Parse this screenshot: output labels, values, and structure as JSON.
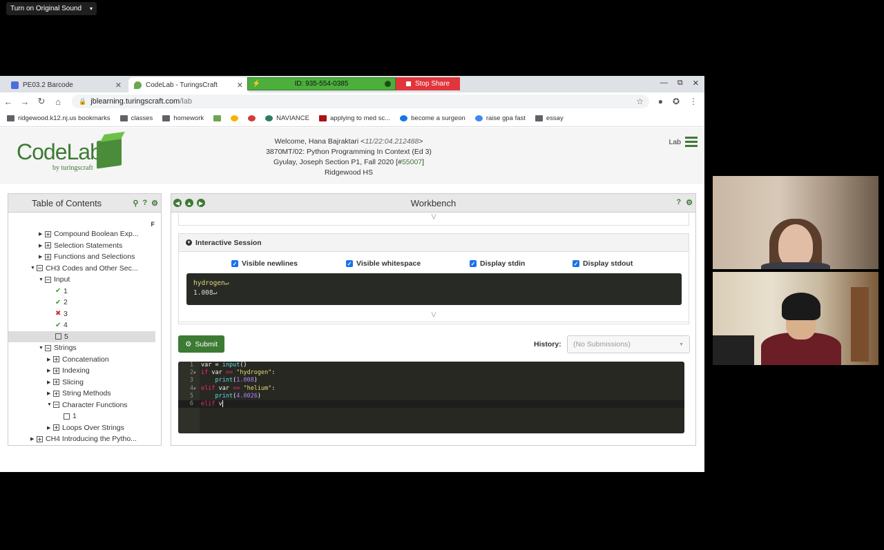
{
  "zoom": {
    "sound_label": "Turn on Original Sound",
    "meeting_id": "ID: 935-554-0385",
    "stop_share": "Stop Share"
  },
  "browser": {
    "tabs": [
      {
        "label": "PE03.2 Barcode"
      },
      {
        "label": "CodeLab - TuringsCraft"
      }
    ],
    "url_host": "jblearning.turingscraft.com",
    "url_path": "/lab",
    "bookmarks": [
      "ridgewood.k12.nj.us bookmarks",
      "classes",
      "homework",
      "NAVIANCE",
      "applying to med sc...",
      "become a surgeon",
      "raise gpa fast",
      "essay"
    ]
  },
  "header": {
    "logo_word": "CodeLab",
    "logo_sub": "by turingscraft",
    "welcome_prefix": "Welcome, Hana Bajraktari <",
    "welcome_time": "11/22:04.212488",
    "welcome_suffix": ">",
    "course": "3870MT/02: Python Programming In Context (Ed 3)",
    "section_prefix": "Gyulay, Joseph  Section P1, Fall 2020  [#",
    "section_id": "55007",
    "section_suffix": "]",
    "school": "Ridgewood HS",
    "lab_label": "Lab"
  },
  "toc": {
    "title": "Table of Contents",
    "f_label": "F",
    "rows": [
      {
        "label": "Compound Boolean Exp..."
      },
      {
        "label": "Selection Statements"
      },
      {
        "label": "Functions and Selections"
      },
      {
        "label": "CH3 Codes and Other Sec..."
      },
      {
        "label": "Input"
      },
      {
        "label": "1"
      },
      {
        "label": "2"
      },
      {
        "label": "3"
      },
      {
        "label": "4"
      },
      {
        "label": "5"
      },
      {
        "label": "Strings"
      },
      {
        "label": "Concatenation"
      },
      {
        "label": "Indexing"
      },
      {
        "label": "Slicing"
      },
      {
        "label": "String Methods"
      },
      {
        "label": "Character Functions"
      },
      {
        "label": "1"
      },
      {
        "label": "Loops Over Strings"
      },
      {
        "label": "CH4 Introducing the Pytho..."
      }
    ]
  },
  "workbench": {
    "title": "Workbench",
    "session_title": "Interactive Session",
    "options": [
      "Visible newlines",
      "Visible whitespace",
      "Display stdin",
      "Display stdout"
    ],
    "console_line1": "hydrogen↵",
    "console_line2": "1.008↵",
    "submit_label": "Submit",
    "history_label": "History:",
    "history_value": "(No Submissions)",
    "code_lines": [
      "1",
      "2",
      "3",
      "4",
      "5",
      "6"
    ]
  },
  "icons": {
    "accent": "#3d7a34"
  }
}
